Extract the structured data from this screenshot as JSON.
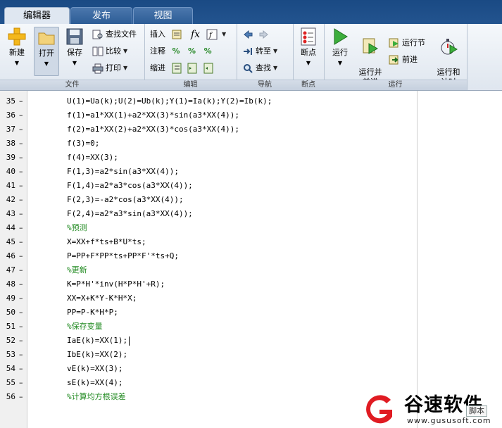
{
  "tabs": [
    {
      "label": "编辑器",
      "active": true
    },
    {
      "label": "发布",
      "active": false
    },
    {
      "label": "视图",
      "active": false
    }
  ],
  "ribbon": {
    "file": {
      "label": "文件",
      "new": "新建",
      "open": "打开",
      "save": "保存",
      "find_files": "查找文件",
      "compare": "比较",
      "print": "打印"
    },
    "edit": {
      "label": "编辑",
      "insert": "插入",
      "fx": "fx",
      "comment": "注释",
      "indent": "缩进"
    },
    "navigate": {
      "label": "导航",
      "goto": "转至",
      "find": "查找"
    },
    "breakpoints": {
      "label": "断点",
      "breakpoints": "断点"
    },
    "run": {
      "label": "运行",
      "run": "运行",
      "run_advance": "运行并\n前进",
      "run_section": "运行节",
      "advance": "前进",
      "run_time": "运行和\n计时"
    }
  },
  "editor": {
    "lines": [
      {
        "num": "35",
        "code": "U(1)=Ua(k);U(2)=Ub(k);Y(1)=Ia(k);Y(2)=Ib(k);",
        "comment": false
      },
      {
        "num": "36",
        "code": "f(1)=a1*XX(1)+a2*XX(3)*sin(a3*XX(4));",
        "comment": false
      },
      {
        "num": "37",
        "code": "f(2)=a1*XX(2)+a2*XX(3)*cos(a3*XX(4));",
        "comment": false
      },
      {
        "num": "38",
        "code": "f(3)=0;",
        "comment": false
      },
      {
        "num": "39",
        "code": "f(4)=XX(3);",
        "comment": false
      },
      {
        "num": "40",
        "code": "F(1,3)=a2*sin(a3*XX(4));",
        "comment": false
      },
      {
        "num": "41",
        "code": "F(1,4)=a2*a3*cos(a3*XX(4));",
        "comment": false
      },
      {
        "num": "42",
        "code": "F(2,3)=-a2*cos(a3*XX(4));",
        "comment": false
      },
      {
        "num": "43",
        "code": "F(2,4)=a2*a3*sin(a3*XX(4));",
        "comment": false
      },
      {
        "num": "44",
        "code": "%预测",
        "comment": true
      },
      {
        "num": "45",
        "code": "X=XX+f*ts+B*U*ts;",
        "comment": false
      },
      {
        "num": "46",
        "code": "P=PP+F*PP*ts+PP*F'*ts+Q;",
        "comment": false
      },
      {
        "num": "47",
        "code": "%更新",
        "comment": true
      },
      {
        "num": "48",
        "code": "K=P*H'*inv(H*P*H'+R);",
        "comment": false
      },
      {
        "num": "49",
        "code": "XX=X+K*Y-K*H*X;",
        "comment": false
      },
      {
        "num": "50",
        "code": "PP=P-K*H*P;",
        "comment": false
      },
      {
        "num": "51",
        "code": "%保存变量",
        "comment": true
      },
      {
        "num": "52",
        "code": "IaE(k)=XX(1);",
        "comment": false
      },
      {
        "num": "53",
        "code": "IbE(k)=XX(2);",
        "comment": false
      },
      {
        "num": "54",
        "code": "vE(k)=XX(3);",
        "comment": false
      },
      {
        "num": "55",
        "code": "sE(k)=XX(4);",
        "comment": false
      },
      {
        "num": "56",
        "code": "%计算均方根误差",
        "comment": true
      }
    ],
    "cursor_line": "52"
  },
  "watermark": {
    "name": "谷速软件",
    "url": "www.gususoft.com",
    "corner": "脚本"
  },
  "colors": {
    "tab_bg": "#1a4a84",
    "comment": "#228b22",
    "brand_red": "#e01b22"
  }
}
